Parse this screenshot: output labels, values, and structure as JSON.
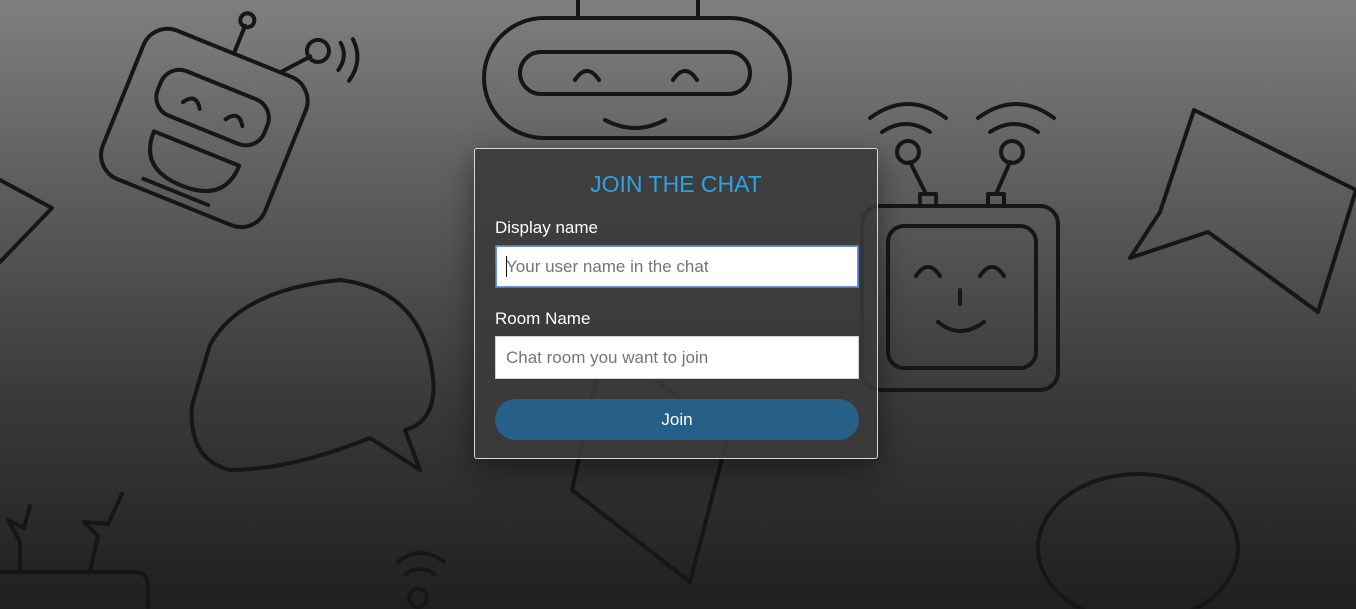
{
  "form": {
    "title": "JOIN THE CHAT",
    "display_name_label": "Display name",
    "display_name_placeholder": "Your user name in the chat",
    "display_name_value": "",
    "room_name_label": "Room Name",
    "room_name_placeholder": "Chat room you want to join",
    "room_name_value": "",
    "join_label": "Join"
  },
  "colors": {
    "title": "#2aa3e6",
    "button": "#266088",
    "card_background": "#3a3a3a",
    "focus_border": "#4a78c8"
  },
  "background": {
    "decorations": [
      "robot-icon",
      "robot-icon",
      "robot-icon",
      "speech-bubble-icon",
      "speech-bubble-icon",
      "speech-bubble-icon",
      "wifi-signal-icon"
    ]
  }
}
